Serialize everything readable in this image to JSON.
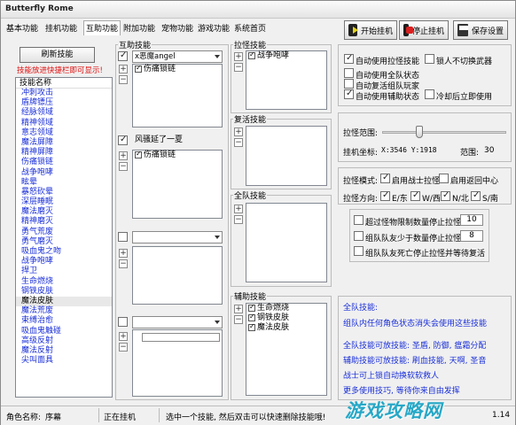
{
  "window": {
    "title": "Butterfly Rome"
  },
  "menu": [
    "基本功能",
    "挂机功能",
    "互助功能",
    "附加功能",
    "宠物功能",
    "游戏功能",
    "系统首页"
  ],
  "toolbar": {
    "start": "开始挂机",
    "stop": "停止挂机",
    "save": "保存设置"
  },
  "left": {
    "refresh": "刷新技能",
    "hint": "技能放进快捷栏即可显示!",
    "list_header": "技能名称",
    "skills": [
      "冲刺攻击",
      "盾牌镖压",
      "经脉领域",
      "精神领域",
      "意志领域",
      "魔法屏障",
      "精神屏障",
      "伤痛锁链",
      "战争咆哮",
      "眩晕",
      "暴怒砍晕",
      "深层睡眠",
      "魔法磨灭",
      "精神磨灭",
      "勇气荒废",
      "勇气磨灭",
      "吸血鬼之吻",
      "战争咆哮",
      "捍卫",
      "生命燃烧",
      "钢铁皮肤",
      "魔法皮肤",
      "魔法荒废",
      "束缚治愈",
      "吸血鬼触碰",
      "高级反射",
      "魔法反射",
      "尖叫面具"
    ],
    "selected_skill": "魔法皮肤"
  },
  "help": {
    "title": "互助技能",
    "slot1": {
      "target": "x恶魔angel",
      "skills": [
        "伤痛锁链"
      ]
    },
    "slot2": {
      "target": "风骚延了一夏",
      "skills": [
        "伤痛锁链"
      ]
    }
  },
  "pull": {
    "title": "拉怪技能",
    "skills": [
      "战争咆哮"
    ]
  },
  "revive": {
    "title": "复活技能"
  },
  "team": {
    "title": "全队技能"
  },
  "assist": {
    "title": "辅助技能",
    "skills": [
      "生命燃烧",
      "钢铁皮肤",
      "魔法皮肤"
    ]
  },
  "options": {
    "auto_pull": "自动使用拉怪技能",
    "lock_weapon": "锁人不切换武器",
    "auto_team": "自动使用全队状态",
    "auto_revive": "自动复活组队玩家",
    "auto_assist": "自动使用辅助状态",
    "cooldown_back": "冷却后立即使用"
  },
  "range": {
    "label": "拉怪范围:",
    "slider_fraction": 0.3,
    "coord_label": "挂机坐标:",
    "coord_value": "X:3546 Y:1918",
    "range_label": "范围:",
    "range_value": "30"
  },
  "mode": {
    "label": "拉怪模式:",
    "warrior": "启用战士拉怪",
    "near": "启用返回中心"
  },
  "direction": {
    "label": "拉怪方向:",
    "e": "E/东",
    "w": "W/西",
    "n": "N/北",
    "s": "S/南"
  },
  "stops": [
    {
      "label": "超过怪物限制数量停止拉怪",
      "value": "10"
    },
    {
      "label": "组队队友少于数量停止拉怪",
      "value": "8"
    },
    {
      "label": "组队队友死亡停止拉怪并等待复活"
    }
  ],
  "info": {
    "title": "全队技能:",
    "line1": "组队内任何角色状态消失会使用这些技能",
    "line2": "全队技能可放技能: 圣盾, 防御, 瘟霜分配",
    "line3": "辅助技能可放技能: 刷血技能, 天啊, 圣音",
    "line4": "战士可上锁自动换软软救人",
    "line5": "更多使用技巧, 等待你来自由发挥"
  },
  "status": {
    "char_label": "角色名称:",
    "char_name": "序幕",
    "state": "正在挂机",
    "tip": "选中一个技能, 然后双击可以快速删除技能哦!",
    "version": "1.14"
  },
  "watermark": "游戏攻略网"
}
